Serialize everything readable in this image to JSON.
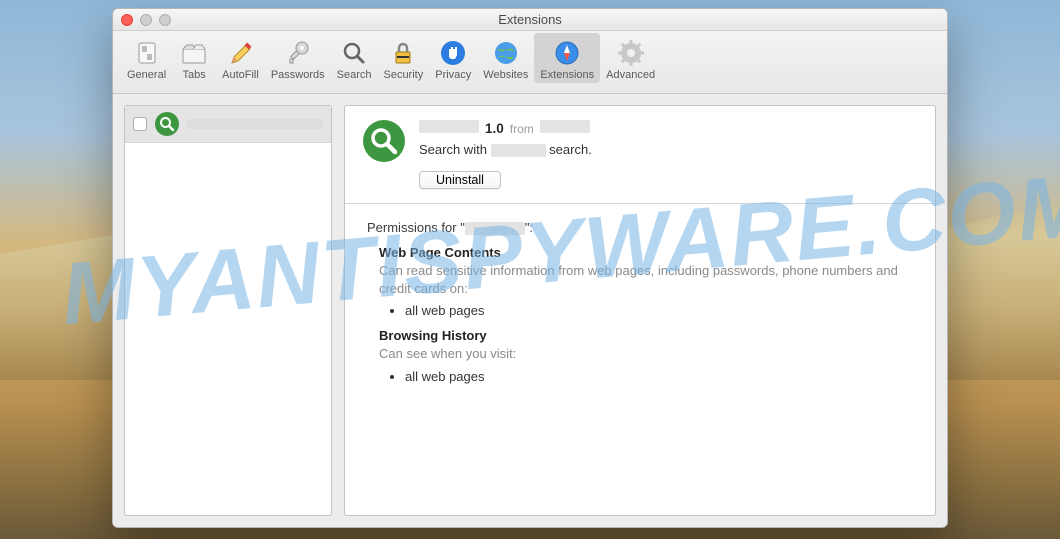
{
  "watermark": "MYANTISPYWARE.COM",
  "window": {
    "title": "Extensions"
  },
  "toolbar": {
    "items": [
      {
        "id": "general",
        "label": "General"
      },
      {
        "id": "tabs",
        "label": "Tabs"
      },
      {
        "id": "autofill",
        "label": "AutoFill"
      },
      {
        "id": "passwords",
        "label": "Passwords"
      },
      {
        "id": "search",
        "label": "Search"
      },
      {
        "id": "security",
        "label": "Security"
      },
      {
        "id": "privacy",
        "label": "Privacy"
      },
      {
        "id": "websites",
        "label": "Websites"
      },
      {
        "id": "extensions",
        "label": "Extensions"
      },
      {
        "id": "advanced",
        "label": "Advanced"
      }
    ],
    "selected": "extensions"
  },
  "sidebar": {
    "items": [
      {
        "name": "",
        "checked": false
      }
    ]
  },
  "extension": {
    "name": "",
    "version": "1.0",
    "from_word": "from",
    "publisher": "",
    "description_pre": "Search with",
    "description_mid": "",
    "description_post": "search.",
    "uninstall_label": "Uninstall"
  },
  "permissions": {
    "title_pre": "Permissions for \"",
    "name": "",
    "title_post": "\":",
    "sections": [
      {
        "title": "Web Page Contents",
        "desc": "Can read sensitive information from web pages, including passwords, phone numbers and credit cards on:",
        "items": [
          "all web pages"
        ]
      },
      {
        "title": "Browsing History",
        "desc": "Can see when you visit:",
        "items": [
          "all web pages"
        ]
      }
    ]
  }
}
